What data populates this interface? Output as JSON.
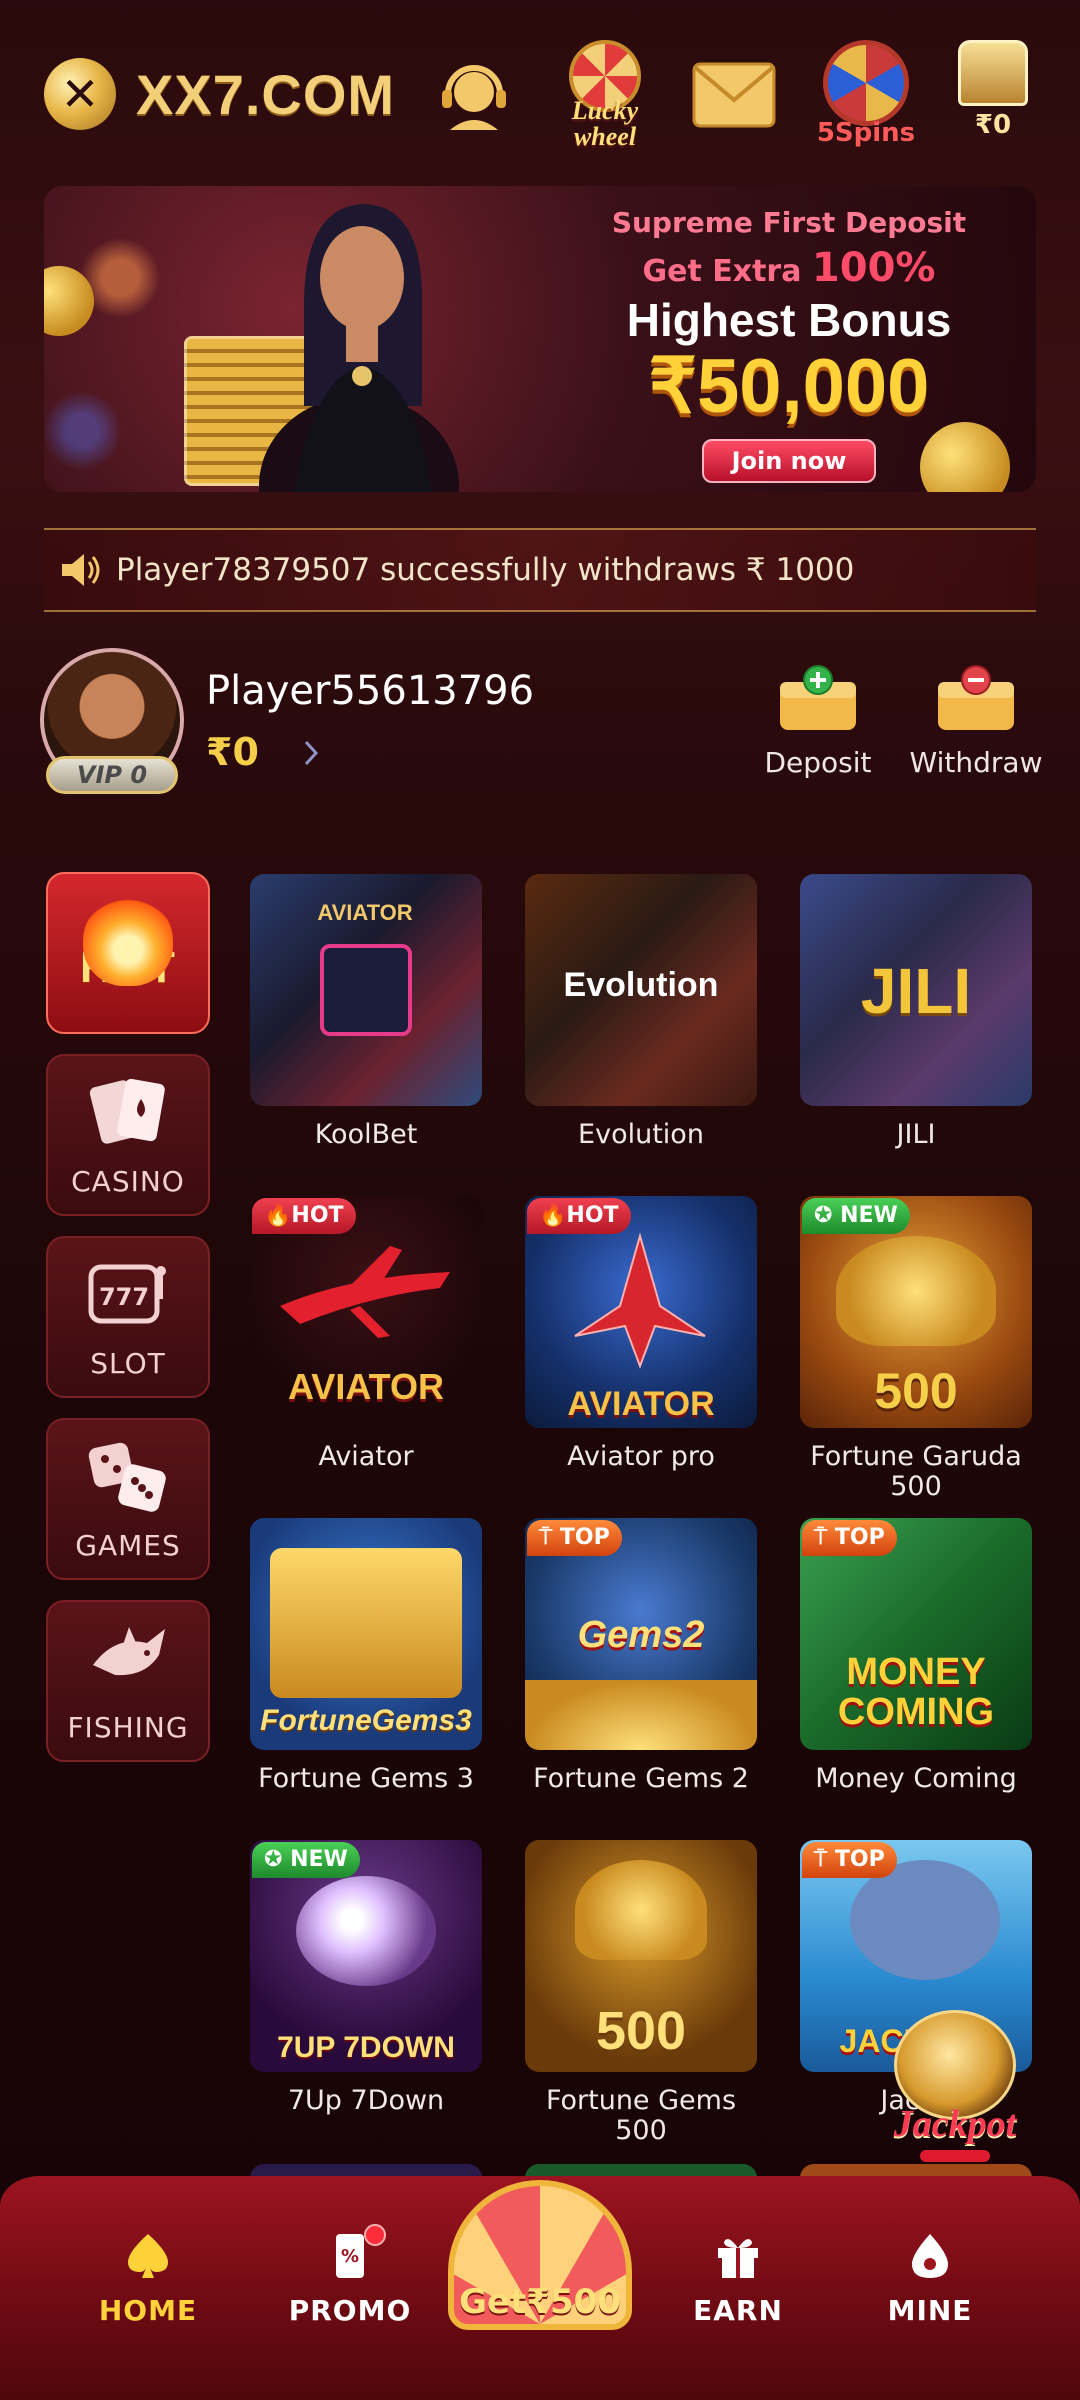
{
  "header": {
    "logo_text": "XX7.COM",
    "lucky_wheel_label": "Lucky wheel",
    "spins_label": "5Spins",
    "chest_label": "₹0"
  },
  "banner": {
    "line1": "Supreme First Deposit",
    "line2_prefix": "Get Extra ",
    "line2_emph": "100%",
    "line3": "Highest Bonus",
    "line4": "₹50,000",
    "button": "Join now"
  },
  "marquee": {
    "message": "Player78379507 successfully withdraws ₹ 1000"
  },
  "profile": {
    "vip": "VIP 0",
    "name": "Player55613796",
    "balance": "₹0",
    "deposit_label": "Deposit",
    "withdraw_label": "Withdraw"
  },
  "categories": [
    {
      "label": "HOT",
      "icon": "flame-icon"
    },
    {
      "label": "CASINO",
      "icon": "cards-icon"
    },
    {
      "label": "SLOT",
      "icon": "slot-machine-icon"
    },
    {
      "label": "GAMES",
      "icon": "dice-icon"
    },
    {
      "label": "FISHING",
      "icon": "shark-icon"
    }
  ],
  "games": [
    {
      "name": "KoolBet",
      "tag": "",
      "art": "",
      "art_color": "#ffffff"
    },
    {
      "name": "Evolution",
      "tag": "",
      "art": "Evolution",
      "art_color": "#ffffff"
    },
    {
      "name": "JILI",
      "tag": "",
      "art": "JILI",
      "art_color": "#f3c53a"
    },
    {
      "name": "Aviator",
      "tag": "HOT",
      "art": "AVIATOR",
      "art_color": "#f6c24a"
    },
    {
      "name": "Aviator pro",
      "tag": "HOT",
      "art": "AVIATOR",
      "art_color": "#f6c24a"
    },
    {
      "name": "Fortune Garuda 500",
      "tag": "NEW",
      "art": "500",
      "art_color": "#f6d04a"
    },
    {
      "name": "Fortune Gems 3",
      "tag": "",
      "art": "FortuneGems3",
      "art_color": "#ffe07a"
    },
    {
      "name": "Fortune Gems 2",
      "tag": "TOP",
      "art": "Gems2",
      "art_color": "#ffe07a"
    },
    {
      "name": "Money Coming",
      "tag": "TOP",
      "art": "MONEY COMING",
      "art_color": "#ffd23a"
    },
    {
      "name": "7Up 7Down",
      "tag": "NEW",
      "art": "7UP 7DOWN",
      "art_color": "#ffe07a"
    },
    {
      "name": "Fortune Gems 500",
      "tag": "",
      "art": "500",
      "art_color": "#ffe07a"
    },
    {
      "name": "JackP",
      "tag": "TOP",
      "art": "JACKPOT",
      "art_color": "#ffd23a"
    }
  ],
  "jackpot": {
    "label": "Jackpot"
  },
  "nav": {
    "home": "HOME",
    "promo": "PROMO",
    "get_bonus": "Get₹500",
    "earn": "EARN",
    "mine": "MINE"
  },
  "colors": {
    "accent_gold": "#f5cf4a",
    "nav_red": "#9c1420",
    "background": "#2a0a0c"
  }
}
